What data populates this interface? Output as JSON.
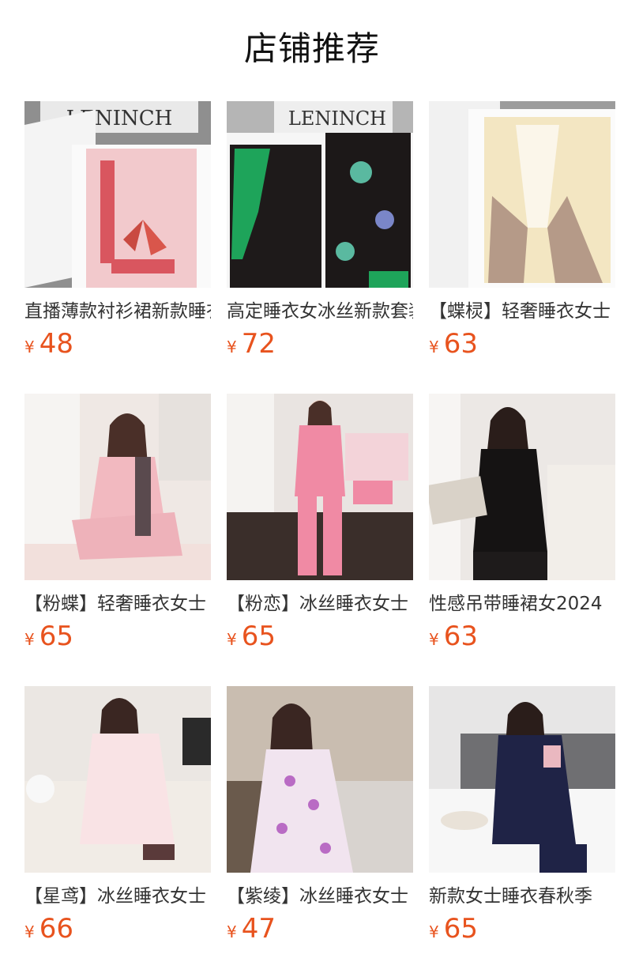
{
  "section_title": "店铺推荐",
  "currency_symbol": "¥",
  "accent_price_color": "#e8531e",
  "products": [
    {
      "name": "直播薄款衬衫裙新款睡衣",
      "price": "48",
      "image": "pink-butterfly-pajamas-in-gift-box"
    },
    {
      "name": "高定睡衣女冰丝新款套装",
      "price": "72",
      "image": "black-green-floral-pajamas-in-gift-box"
    },
    {
      "name": "【蝶棂】轻奢睡衣女士",
      "price": "63",
      "image": "cream-lace-pajamas-in-gift-box"
    },
    {
      "name": "【粉蝶】轻奢睡衣女士",
      "price": "65",
      "image": "model-pink-butterfly-pajamas-bedroom"
    },
    {
      "name": "【粉恋】冰丝睡衣女士",
      "price": "65",
      "image": "model-pink-printed-pajamas-room"
    },
    {
      "name": "性感吊带睡裙女2024",
      "price": "63",
      "image": "model-black-lace-robe-bedroom"
    },
    {
      "name": "【星鸢】冰丝睡衣女士",
      "price": "66",
      "image": "model-light-pink-pajamas-bed"
    },
    {
      "name": "【紫绫】冰丝睡衣女士",
      "price": "47",
      "image": "model-purple-floral-dress-sofa"
    },
    {
      "name": "新款女士睡衣春秋季",
      "price": "65",
      "image": "model-navy-pajamas-bed"
    }
  ]
}
